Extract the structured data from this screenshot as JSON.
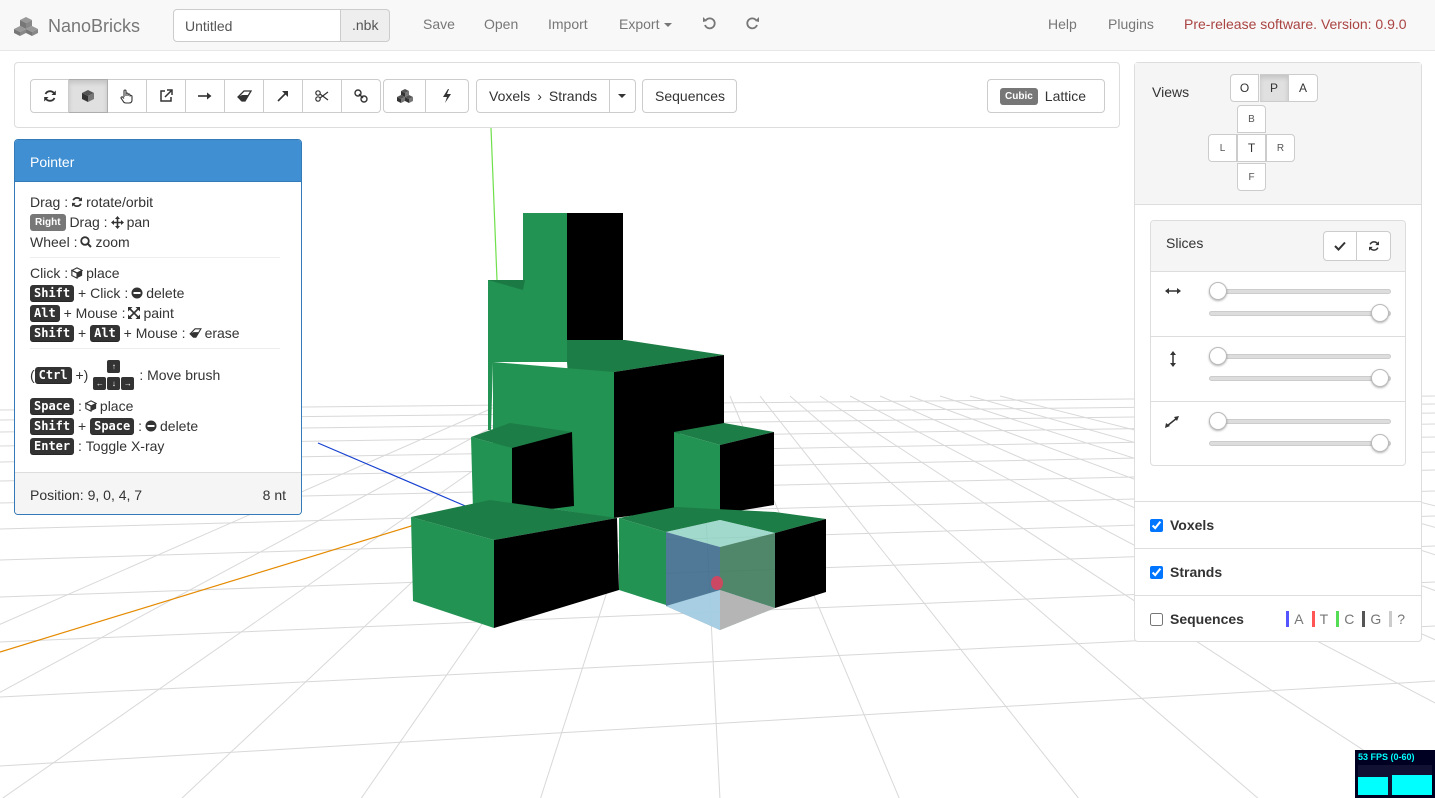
{
  "brand": {
    "name": "NanoBricks"
  },
  "file": {
    "name": "Untitled",
    "extension": ".nbk"
  },
  "nav": {
    "save": "Save",
    "open": "Open",
    "import": "Import",
    "export": "Export",
    "help": "Help",
    "plugins": "Plugins",
    "version": "Pre-release software. Version: 0.9.0"
  },
  "toolbar": {
    "tools": [
      "rotate-icon",
      "cube-icon",
      "hand-icon",
      "external-link-icon",
      "arrow-right-icon",
      "eraser-icon",
      "arrow-diagonal-icon",
      "scissors-icon",
      "link-icon"
    ],
    "active_tool": "cube-icon",
    "extra_tools": [
      "cubes-icon",
      "bolt-icon"
    ],
    "mode": {
      "from": "Voxels",
      "separator": "›",
      "to": "Strands"
    },
    "sequences": "Sequences",
    "lattice_badge": "Cubic",
    "lattice": "Lattice"
  },
  "pointer": {
    "title": "Pointer",
    "drag": "Drag",
    "rotate": "rotate/orbit",
    "right": "Right",
    "pan": "pan",
    "wheel": "Wheel",
    "zoom": "zoom",
    "click": "Click",
    "place": "place",
    "shift": "Shift",
    "delete": "delete",
    "alt": "Alt",
    "mouse": "Mouse",
    "paint": "paint",
    "erase": "erase",
    "ctrl": "Ctrl",
    "move_brush": "Move brush",
    "space": "Space",
    "enter": "Enter",
    "xray": "Toggle X-ray",
    "position": "Position: 9, 0, 4, 7",
    "count": "8 nt"
  },
  "views": {
    "title": "Views",
    "ortho": "O",
    "perspective": "P",
    "anaglyph": "A",
    "active": "P",
    "back": "B",
    "left": "L",
    "top": "T",
    "right": "R",
    "front": "F"
  },
  "slices": {
    "title": "Slices",
    "rows": [
      {
        "icon": "horizontal-arrows-icon",
        "min": 0,
        "max": 1
      },
      {
        "icon": "vertical-arrows-icon",
        "min": 0,
        "max": 1
      },
      {
        "icon": "diagonal-arrows-icon",
        "min": 0,
        "max": 1
      }
    ]
  },
  "display": {
    "voxels": {
      "label": "Voxels",
      "checked": true
    },
    "strands": {
      "label": "Strands",
      "checked": true
    },
    "sequences": {
      "label": "Sequences",
      "checked": false
    }
  },
  "bases": [
    {
      "letter": "A",
      "color": "#5555ff"
    },
    {
      "letter": "T",
      "color": "#ff5555"
    },
    {
      "letter": "C",
      "color": "#55dd55"
    },
    {
      "letter": "G",
      "color": "#555555"
    },
    {
      "letter": "?",
      "color": "#cccccc"
    }
  ],
  "fps": {
    "text": "53 FPS (0-60)"
  },
  "colors": {
    "voxel": "#22904f",
    "primary": "#337ab7",
    "danger": "#a94442"
  }
}
